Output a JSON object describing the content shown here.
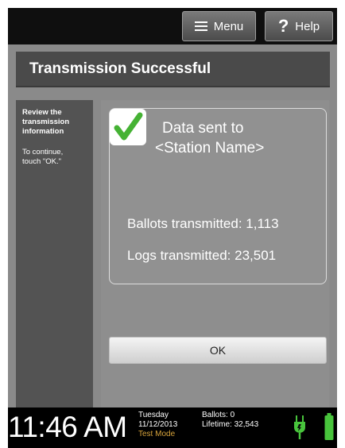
{
  "header": {
    "menu_label": "Menu",
    "help_glyph": "?",
    "help_label": "Help"
  },
  "title": "Transmission Successful",
  "sidebar": {
    "heading": "Review the transmission information",
    "note": "To continue, touch \"OK.\""
  },
  "result": {
    "line1": "Data sent to",
    "line2": "<Station Name>",
    "ballots": "Ballots transmitted: 1,113",
    "logs": "Logs transmitted: 23,501"
  },
  "ok_label": "OK",
  "status": {
    "time": "11:46 AM",
    "day": "Tuesday",
    "date": "11/12/2013",
    "mode": "Test Mode",
    "ballots": "Ballots:  0",
    "lifetime": "Lifetime: 32,543",
    "power_icon": "plug-icon",
    "battery_icon": "battery-icon"
  },
  "colors": {
    "check": "#45b234",
    "status_icons": "#48c43c",
    "test_mode": "#d7a33b"
  }
}
